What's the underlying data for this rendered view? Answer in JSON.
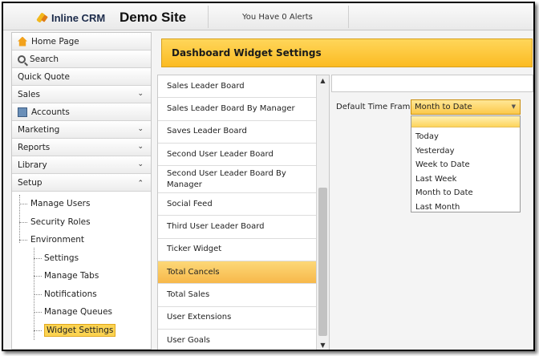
{
  "header": {
    "app_name": "Inline CRM",
    "site_name": "Demo Site",
    "alerts_text": "You Have 0 Alerts"
  },
  "sidebar": {
    "items": [
      {
        "label": "Home Page",
        "icon": "home-icon"
      },
      {
        "label": "Search",
        "icon": "search-icon"
      },
      {
        "label": "Quick Quote"
      },
      {
        "label": "Sales",
        "expandable": true
      },
      {
        "label": "Accounts",
        "icon": "accounts-icon"
      },
      {
        "label": "Marketing",
        "expandable": true
      },
      {
        "label": "Reports",
        "expandable": true
      },
      {
        "label": "Library",
        "expandable": true
      },
      {
        "label": "Setup",
        "expanded": true
      }
    ],
    "setup_tree": {
      "manage_users": "Manage Users",
      "security_roles": "Security Roles",
      "environment": "Environment",
      "children": [
        "Settings",
        "Manage Tabs",
        "Notifications",
        "Manage Queues",
        "Widget Settings"
      ],
      "selected": "Widget Settings"
    }
  },
  "main": {
    "title": "Dashboard Widget Settings",
    "widgets": [
      "Sales Leader Board",
      "Sales Leader Board By Manager",
      "Saves Leader Board",
      "Second User Leader Board",
      "Second User Leader Board By Manager",
      "Social Feed",
      "Third User Leader Board",
      "Ticker Widget",
      "Total Cancels",
      "Total Sales",
      "User Extensions",
      "User Goals"
    ],
    "selected_widget": "Total Cancels",
    "time_frame_label": "Default Time Frame:",
    "time_frame_value": "Month to Date",
    "time_frame_options": [
      "Today",
      "Yesterday",
      "Week to Date",
      "Last Week",
      "Month to Date",
      "Last Month"
    ]
  },
  "colors": {
    "accent": "#fbbb22",
    "selected": "#f7b84a",
    "brand_text": "#1c2b4a"
  }
}
